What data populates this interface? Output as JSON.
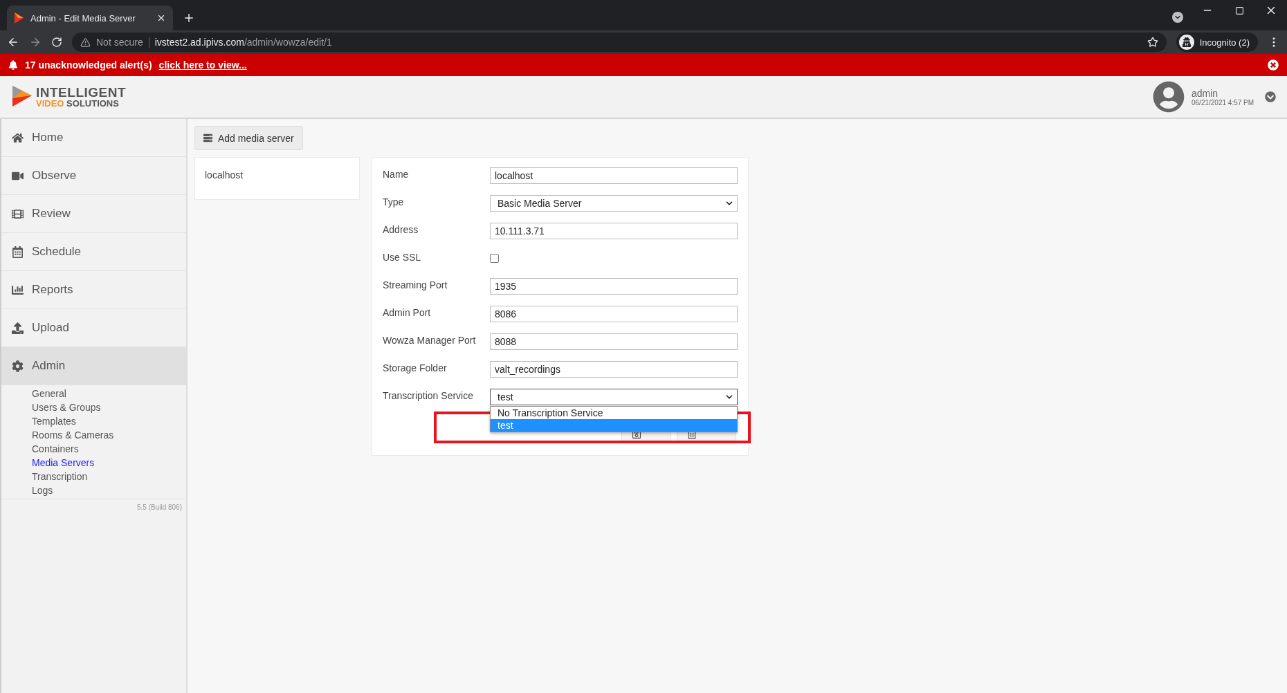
{
  "browser": {
    "tab": {
      "title": "Admin - Edit Media Server",
      "selected": true
    },
    "address": {
      "security": "Not secure",
      "host": "ivstest2.ad.ipivs.com",
      "path": "/admin/wowza/edit/1"
    },
    "profile": "Incognito (2)"
  },
  "alert": {
    "text": "17 unacknowledged alert(s)",
    "link": "click here to view..."
  },
  "header": {
    "logo": {
      "line1": "INTELLIGENT",
      "line2a": "VIDEO",
      "line2b": "SOLUTIONS"
    },
    "user": {
      "name": "admin",
      "datetime": "06/21/2021 4:57 PM"
    }
  },
  "sidebar": {
    "items": [
      {
        "label": "Home",
        "selected": false
      },
      {
        "label": "Observe",
        "selected": false
      },
      {
        "label": "Review",
        "selected": false
      },
      {
        "label": "Schedule",
        "selected": false
      },
      {
        "label": "Reports",
        "selected": false
      },
      {
        "label": "Upload",
        "selected": false
      },
      {
        "label": "Admin",
        "selected": true,
        "expanded": true,
        "children": [
          {
            "label": "General",
            "selected": false
          },
          {
            "label": "Users & Groups",
            "selected": false
          },
          {
            "label": "Templates",
            "selected": false
          },
          {
            "label": "Rooms & Cameras",
            "selected": false
          },
          {
            "label": "Containers",
            "selected": false
          },
          {
            "label": "Media Servers",
            "selected": true
          },
          {
            "label": "Transcription",
            "selected": false
          },
          {
            "label": "Logs",
            "selected": false
          }
        ]
      }
    ],
    "version": "5.5 (Build 806)"
  },
  "toolbar": {
    "add_button": "Add media server"
  },
  "server_list": [
    "localhost"
  ],
  "form": {
    "fields": [
      {
        "label": "Name",
        "kind": "text",
        "value": "localhost"
      },
      {
        "label": "Type",
        "kind": "select",
        "value": "Basic Media Server"
      },
      {
        "label": "Address",
        "kind": "text",
        "value": "10.111.3.71"
      },
      {
        "label": "Use SSL",
        "kind": "checkbox",
        "checked": false
      },
      {
        "label": "Streaming Port",
        "kind": "text",
        "value": "1935"
      },
      {
        "label": "Admin Port",
        "kind": "text",
        "value": "8086"
      },
      {
        "label": "Wowza Manager Port",
        "kind": "text",
        "value": "8088"
      },
      {
        "label": "Storage Folder",
        "kind": "text",
        "value": "valt_recordings"
      },
      {
        "label": "Transcription Service",
        "kind": "select",
        "value": "test",
        "expanded": true,
        "options": [
          {
            "label": "No Transcription Service",
            "selected": false
          },
          {
            "label": "test",
            "selected": true
          }
        ]
      }
    ],
    "buttons": [
      {
        "kind": "save"
      },
      {
        "kind": "delete"
      }
    ]
  },
  "annotation": {
    "kind": "rectangle"
  }
}
